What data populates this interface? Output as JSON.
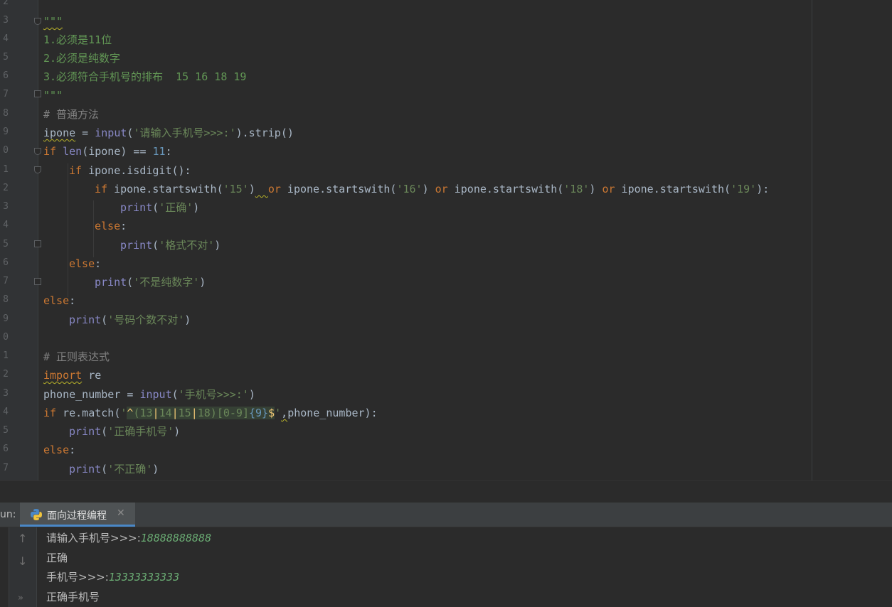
{
  "editor": {
    "line_numbers": [
      "2",
      "3",
      "4",
      "5",
      "6",
      "7",
      "8",
      "9",
      "0",
      "1",
      "2",
      "3",
      "4",
      "5",
      "6",
      "7",
      "8",
      "9",
      "0",
      "1",
      "2",
      "3",
      "4",
      "5",
      "6",
      "7"
    ],
    "docstring_open": "\"\"\"",
    "doc1": "1.必须是11位",
    "doc2": "2.必须是纯数字",
    "doc3": "3.必须符合手机号的排布  15 16 18 19",
    "docstring_close": "\"\"\"",
    "comment1": "# 普通方法",
    "c9_var": "ipone",
    "c9_eq": " = ",
    "c9_fn": "input",
    "c9_p1": "(",
    "c9_str": "'请输入手机号>>>:'",
    "c9_rest": ").strip()",
    "c10_if": "if",
    "c10_sp": " ",
    "c10_len": "len",
    "c10_mid": "(ipone) == ",
    "c10_num": "11",
    "c10_end": ":",
    "c11_if": "if",
    "c11_rest": " ipone.isdigit():",
    "c12_if": "if",
    "c12_a": " ipone.startswith(",
    "c12_s1": "'15'",
    "c12_b": ")",
    "c12_sp": "  ",
    "c12_or1": "or",
    "c12_c": " ipone.startswith(",
    "c12_s2": "'16'",
    "c12_d": ") ",
    "c12_or2": "or",
    "c12_e": " ipone.startswith(",
    "c12_s3": "'18'",
    "c12_f": ") ",
    "c12_or3": "or",
    "c12_g": " ipone.startswith(",
    "c12_s4": "'19'",
    "c12_h": "):",
    "c13_fn": "print",
    "c13_a": "(",
    "c13_s": "'正确'",
    "c13_b": ")",
    "c14_else": "else",
    "c14_c": ":",
    "c15_fn": "print",
    "c15_a": "(",
    "c15_s": "'格式不对'",
    "c15_b": ")",
    "c16_else": "else",
    "c16_c": ":",
    "c17_fn": "print",
    "c17_a": "(",
    "c17_s": "'不是纯数字'",
    "c17_b": ")",
    "c18_else": "else",
    "c18_c": ":",
    "c19_fn": "print",
    "c19_a": "(",
    "c19_s": "'号码个数不对'",
    "c19_b": ")",
    "comment2": "# 正则表达式",
    "c22_import": "import",
    "c22_rest": " re",
    "c23_var": "phone_number = ",
    "c23_fn": "input",
    "c23_a": "(",
    "c23_s": "'手机号>>>:'",
    "c23_b": ")",
    "c24_if": "if",
    "c24_a": " re.match(",
    "c24_q1": "'",
    "c24_r1": "^",
    "c24_r2": "(13",
    "c24_r3": "|",
    "c24_r4": "14",
    "c24_r5": "|",
    "c24_r6": "15",
    "c24_r7": "|",
    "c24_r8": "18)",
    "c24_r9": "[0-9]",
    "c24_r10": "{9}",
    "c24_r11": "$",
    "c24_q2": "'",
    "c24_comma": ",",
    "c24_b": "phone_number):",
    "c25_fn": "print",
    "c25_a": "(",
    "c25_s": "'正确手机号'",
    "c25_b": ")",
    "c26_else": "else",
    "c26_c": ":",
    "c27_fn": "print",
    "c27_a": "(",
    "c27_s": "'不正确'",
    "c27_b": ")"
  },
  "run": {
    "label": "un:",
    "tab_label": "面向过程编程",
    "close_glyph": "✕",
    "python_icon": "python-icon"
  },
  "console": {
    "tools": {
      "up": "↑",
      "down": "↓",
      "more": "»"
    },
    "line1_prompt": "请输入手机号>>>:",
    "line1_input": "18888888888",
    "line2": "正确",
    "line3_prompt": "手机号>>>:",
    "line3_input": "13333333333",
    "line4": "正确手机号"
  },
  "colors": {
    "keyword": "#cc7832",
    "string": "#6a8759",
    "builtin": "#8888c6",
    "number": "#6897bb",
    "comment": "#808080",
    "docstring": "#629755",
    "console_input": "#6aab73"
  }
}
